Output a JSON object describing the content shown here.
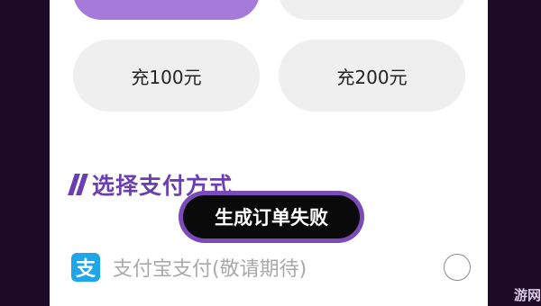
{
  "recharge_options": [
    {
      "label": "",
      "selected": true
    },
    {
      "label": "",
      "selected": false
    },
    {
      "label": "充100元",
      "selected": false
    },
    {
      "label": "充200元",
      "selected": false
    }
  ],
  "payment_section": {
    "title": "选择支付方式",
    "methods": [
      {
        "icon": "alipay-icon",
        "icon_text": "支",
        "label": "支付宝支付(敬请期待)",
        "checked": false
      }
    ]
  },
  "toast": {
    "message": "生成订单失败"
  },
  "watermark": "游网",
  "colors": {
    "accent": "#a67ad8",
    "title": "#6a3fb2",
    "toast_border": "#7b4bb8",
    "alipay": "#1ea6e8"
  }
}
